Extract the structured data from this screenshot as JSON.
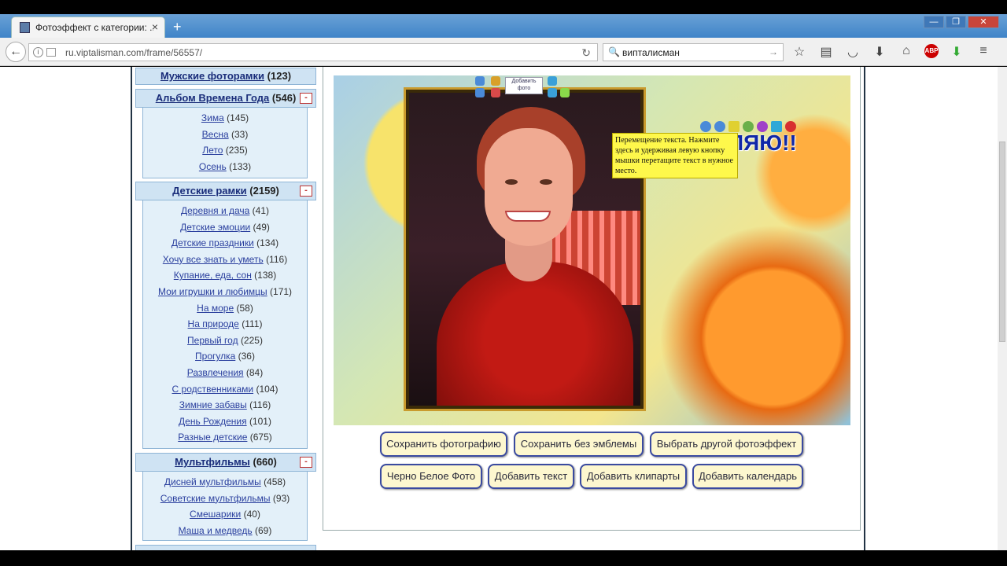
{
  "browser": {
    "tab_title": "Фотоэффект с категории: ...",
    "new_tab": "+",
    "url": "ru.viptalisman.com/frame/56557/",
    "search_text": "випталисман",
    "window_controls": [
      "—",
      "❐",
      "✕"
    ]
  },
  "sidebar": {
    "top_category": {
      "name": "Мужские фоторамки",
      "count": "(123)"
    },
    "categories": [
      {
        "name": "Альбом Времена Года",
        "count": "(546)",
        "toggle": "-",
        "items": [
          {
            "label": "Зима",
            "count": "(145)"
          },
          {
            "label": "Весна",
            "count": "(33)"
          },
          {
            "label": "Лето",
            "count": "(235)"
          },
          {
            "label": "Осень",
            "count": "(133)"
          }
        ]
      },
      {
        "name": "Детские рамки",
        "count": "(2159)",
        "toggle": "-",
        "items": [
          {
            "label": "Деревня и дача",
            "count": "(41)"
          },
          {
            "label": "Детские эмоции",
            "count": "(49)"
          },
          {
            "label": "Детские праздники",
            "count": "(134)"
          },
          {
            "label": "Хочу все знать и уметь",
            "count": "(116)"
          },
          {
            "label": "Купание, еда, сон",
            "count": "(138)"
          },
          {
            "label": "Мои игрушки и любимцы",
            "count": "(171)"
          },
          {
            "label": "На море",
            "count": "(58)"
          },
          {
            "label": "На природе",
            "count": "(111)"
          },
          {
            "label": "Первый год",
            "count": "(225)"
          },
          {
            "label": "Прогулка",
            "count": "(36)"
          },
          {
            "label": "Развлечения",
            "count": "(84)"
          },
          {
            "label": "С родственниками",
            "count": "(104)"
          },
          {
            "label": "Зимние забавы",
            "count": "(116)"
          },
          {
            "label": "День Рождения",
            "count": "(101)"
          },
          {
            "label": "Разные детские",
            "count": "(675)"
          }
        ]
      },
      {
        "name": "Мультфильмы",
        "count": "(660)",
        "toggle": "-",
        "items": [
          {
            "label": "Дисней мультфильмы",
            "count": "(458)"
          },
          {
            "label": "Советские мультфильмы",
            "count": "(93)"
          },
          {
            "label": "Смешарики",
            "count": "(40)"
          },
          {
            "label": "Маша и медведь",
            "count": "(69)"
          }
        ]
      }
    ]
  },
  "editor": {
    "add_photo": "Добавить фото",
    "overlay_text": "ЗДРАВЛЯЮ!!",
    "tooltip": "Перемещение текста. Нажмите здесь и удерживая левую кнопку мышки перетащите текст в нужное место."
  },
  "buttons": {
    "save_photo": "Сохранить фотографию",
    "save_no_logo": "Сохранить без эмблемы",
    "choose_effect": "Выбрать другой фотоэффект",
    "bw_photo": "Черно Белое Фото",
    "add_text": "Добавить текст",
    "add_clipart": "Добавить клипарты",
    "add_calendar": "Добавить календарь"
  }
}
